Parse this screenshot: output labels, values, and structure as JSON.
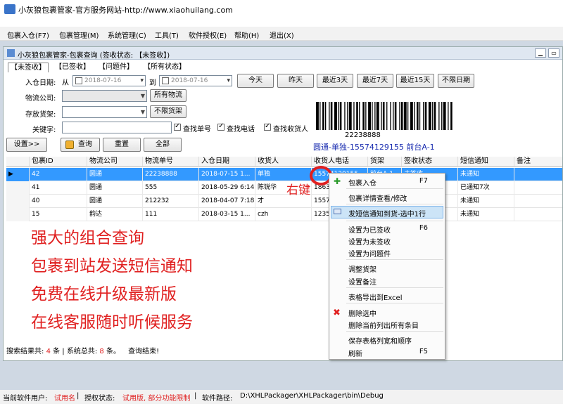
{
  "window_title": "小灰狼包裹管家-官方服务网站-http://www.xiaohuilang.com",
  "menu": [
    "包裹入仓(F7)",
    "包裹管理(M)",
    "系统管理(C)",
    "工具(T)",
    "软件授权(E)",
    "帮助(H)",
    "退出(X)"
  ],
  "child_title": "小灰狼包裹管家-包裹查询 (签收状态: 【未签收】)",
  "tabs": [
    "【未签收】",
    "【已签收】",
    "【问题件】",
    "【所有状态】"
  ],
  "filters": {
    "date_label": "入仓日期:",
    "from_label": "从",
    "to_label": "到",
    "date_from": "2018-07-16",
    "date_to": "2018-07-16",
    "company_label": "物流公司:",
    "shelf_label": "存放货架:",
    "keyword_label": "关键字:",
    "all_company_btn": "所有物流",
    "all_shelf_btn": "不限货架",
    "chk_tracking": "查找单号",
    "chk_phone": "查找电话",
    "chk_receiver": "查找收货人"
  },
  "date_buttons": [
    "今天",
    "昨天",
    "最近3天",
    "最近7天",
    "最近15天",
    "不限日期"
  ],
  "action_buttons": {
    "settings": "设置>>",
    "query": "查询",
    "reset": "重置",
    "all": "全部"
  },
  "barcode": {
    "number": "22238888",
    "caption": "圆通-单独-15574129155 前台A-1"
  },
  "grid": {
    "headers": [
      "包裹ID",
      "物流公司",
      "物流单号",
      "入仓日期",
      "收货人",
      "收货人电话",
      "货架",
      "签收状态",
      "短信通知",
      "备注"
    ],
    "rows": [
      [
        "42",
        "圆通",
        "22238888",
        "2018-07-15 1...",
        "单独",
        "15574129155",
        "前台A-1",
        "未签收",
        "未通知",
        ""
      ],
      [
        "41",
        "圆通",
        "555",
        "2018-05-29 6:14",
        "陈锐华",
        "18632",
        "",
        "",
        "已通知7次",
        ""
      ],
      [
        "40",
        "圆通",
        "212232",
        "2018-04-07 7:18",
        "才",
        "15574",
        "",
        "",
        "未通知",
        ""
      ],
      [
        "15",
        "韵达",
        "111",
        "2018-03-15 1...",
        "czh",
        "12355",
        "",
        "",
        "未通知",
        ""
      ]
    ]
  },
  "promo": [
    "强大的组合查询",
    "包裹到站发送短信通知",
    "免费在线升级最新版",
    "在线客服随时听候服务"
  ],
  "annotation": "右键",
  "context_menu": {
    "items": [
      {
        "label": "包裹入仓",
        "shortcut": "F7"
      },
      {
        "label": "包裹详情查看/修改",
        "shortcut": ""
      },
      {
        "label": "发短信通知到货-选中1行",
        "shortcut": ""
      },
      {
        "label": "设置为已签收",
        "shortcut": "F6"
      },
      {
        "label": "设置为未签收",
        "shortcut": ""
      },
      {
        "label": "设置为问题件",
        "shortcut": ""
      },
      {
        "label": "调整货架",
        "shortcut": ""
      },
      {
        "label": "设置备注",
        "shortcut": ""
      },
      {
        "label": "表格导出到Excel",
        "shortcut": ""
      },
      {
        "label": "删除选中",
        "shortcut": ""
      },
      {
        "label": "删除当前列出所有条目",
        "shortcut": ""
      },
      {
        "label": "保存表格列宽和顺序",
        "shortcut": ""
      },
      {
        "label": "刷新",
        "shortcut": "F5"
      }
    ]
  },
  "status": {
    "prefix": "搜索结果共:",
    "count": "4",
    "unit1": "条 | 系统总共:",
    "total": "8",
    "unit2": "条。",
    "result": "查询结束!"
  },
  "footer": {
    "user_label": "当前软件用户:",
    "user": "试用名",
    "auth_label": "授权状态:",
    "auth": "试用版, 部分功能限制",
    "path_label": "软件路径:",
    "path": "D:\\XHLPackager\\XHLPackager\\bin\\Debug"
  },
  "colors": {
    "accent": "#3399ff",
    "promo": "#e02020",
    "barcode_caption": "#1a2db0"
  }
}
